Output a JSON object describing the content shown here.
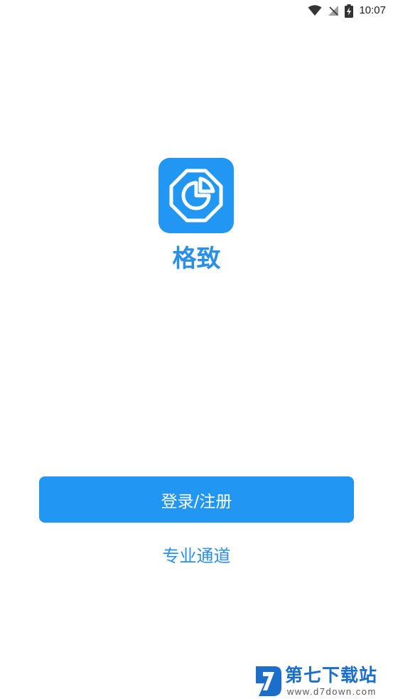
{
  "status_bar": {
    "time": "10:07",
    "icons": [
      "wifi-icon",
      "no-signal-icon",
      "battery-charging-icon"
    ]
  },
  "app": {
    "name": "格致",
    "logo_icon": "gezhi-logo-icon",
    "brand_color": "#2196f3"
  },
  "actions": {
    "login_label": "登录/注册",
    "pro_channel_label": "专业通道"
  },
  "watermark": {
    "title": "第七下载站",
    "url": "www.d7down.com"
  }
}
